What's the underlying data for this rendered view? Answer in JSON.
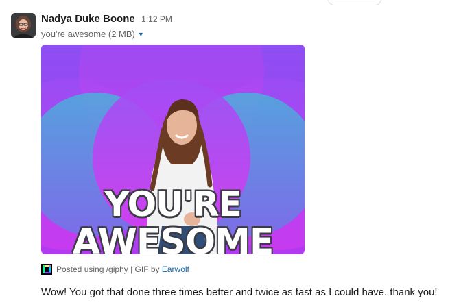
{
  "message": {
    "author": "Nadya Duke Boone",
    "time": "1:12 PM",
    "attachment_title": "you're awesome (2 MB)",
    "gif_overlay": {
      "line1": "YOU'RE",
      "line2": "AWESOME"
    },
    "giphy": {
      "posted_using": "Posted using /giphy | GIF by ",
      "source_link": "Earwolf"
    },
    "text": "Wow! You got that done three times better and twice as fast as I could have. thank you!"
  },
  "colors": {
    "link": "#1264a3",
    "gif_bg_purple": "#9b3df0",
    "gif_circle_teal": "#3fb0d6"
  }
}
